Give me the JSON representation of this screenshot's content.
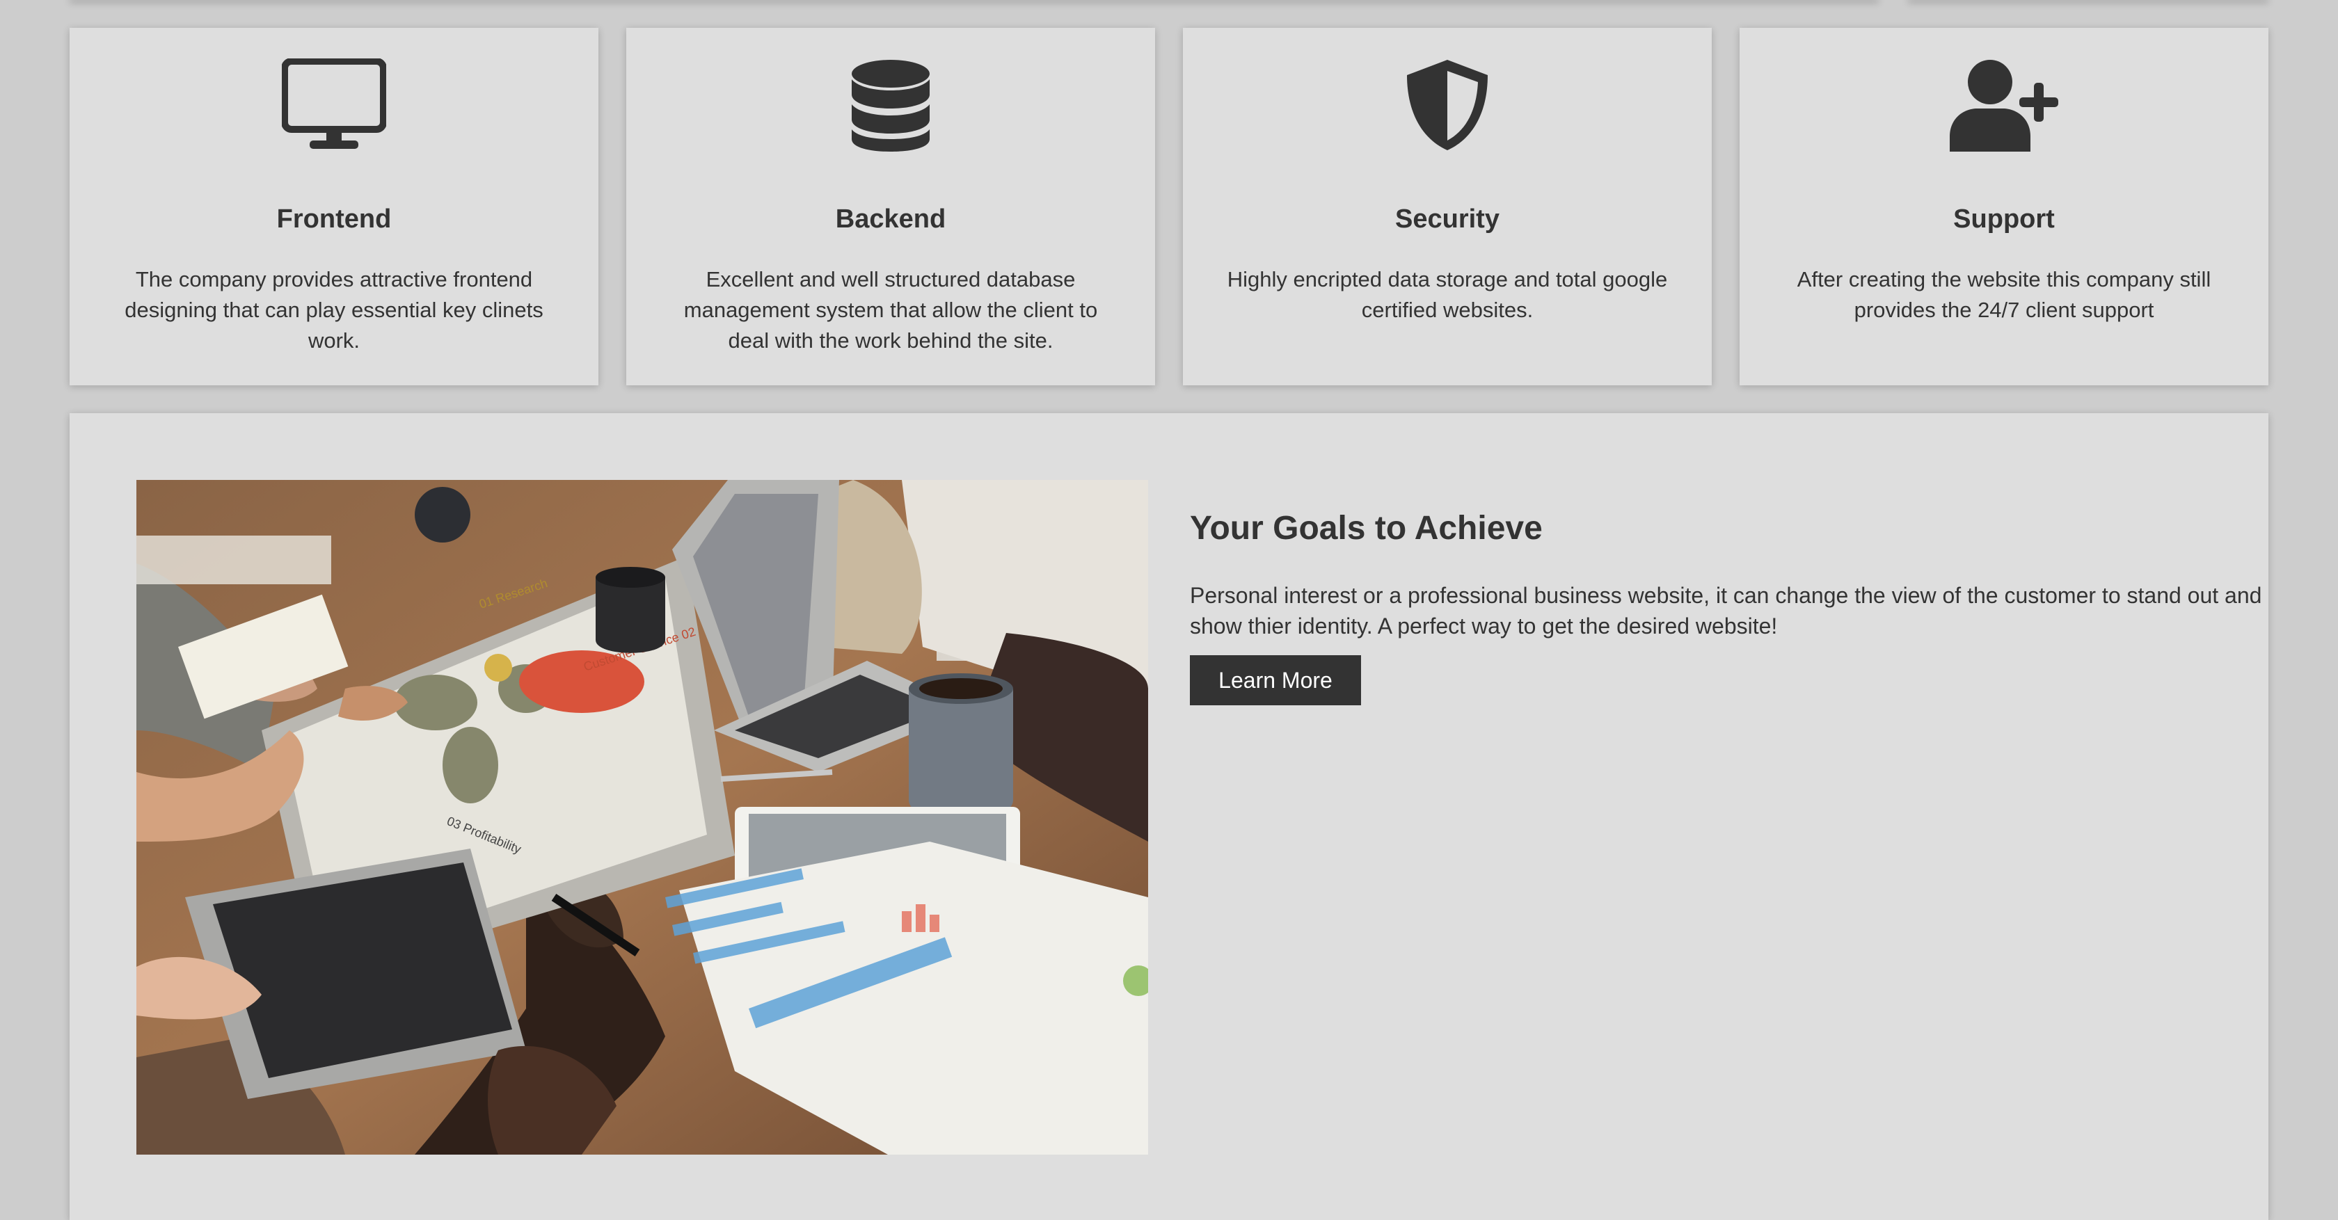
{
  "services": [
    {
      "icon": "monitor-icon",
      "title": "Frontend",
      "text": "The company provides attractive frontend designing that can play essential key clinets work."
    },
    {
      "icon": "database-icon",
      "title": "Backend",
      "text": "Excellent and well structured database management system that allow the client to deal with the work behind the site."
    },
    {
      "icon": "shield-icon",
      "title": "Security",
      "text": "Highly encripted data storage and total google certified websites."
    },
    {
      "icon": "user-plus-icon",
      "title": "Support",
      "text": "After creating the website this company still provides the 24/7 client support"
    }
  ],
  "goals": {
    "title": "Your Goals to Achieve",
    "text": "Personal interest or a professional business website, it can change the view of the customer to stand out and show thier identity. A perfect way to get the desired website!",
    "button_label": "Learn More"
  },
  "photo": {
    "laptop_labels": [
      "01 Research",
      "Customer Service 02",
      "03 Profitability"
    ]
  },
  "colors": {
    "page_bg": "#cdcdcd",
    "card_bg": "#dedede",
    "text": "#333333",
    "button_bg": "#333333",
    "button_text": "#ffffff"
  }
}
